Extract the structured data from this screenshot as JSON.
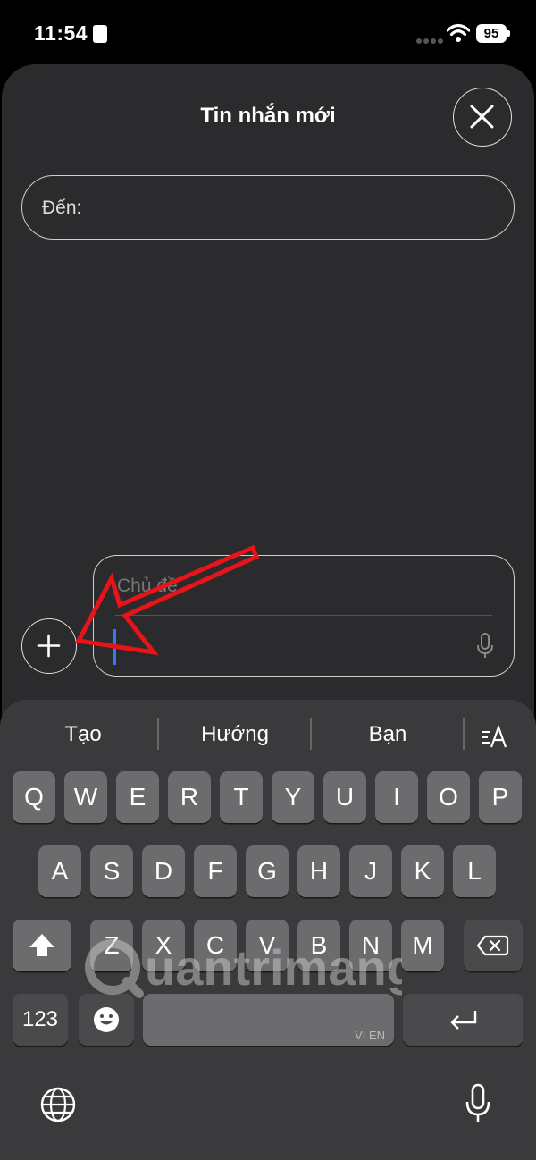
{
  "status_bar": {
    "time": "11:54",
    "battery": "95"
  },
  "sheet": {
    "title": "Tin nhắn mới",
    "to_label": "Đến:",
    "subject_placeholder": "Chủ đề"
  },
  "suggestions": [
    "Tạo",
    "Hướng",
    "Bạn"
  ],
  "keyboard": {
    "row1": [
      "Q",
      "W",
      "E",
      "R",
      "T",
      "Y",
      "U",
      "I",
      "O",
      "P"
    ],
    "row2": [
      "A",
      "S",
      "D",
      "F",
      "G",
      "H",
      "J",
      "K",
      "L"
    ],
    "row3": [
      "Z",
      "X",
      "C",
      "V",
      "B",
      "N",
      "M"
    ],
    "numbers_key": "123",
    "space_label": "VI EN"
  },
  "watermark": "uantrimang",
  "colors": {
    "accent_cursor": "#2b7cff",
    "annotation_arrow": "#e8141a"
  }
}
